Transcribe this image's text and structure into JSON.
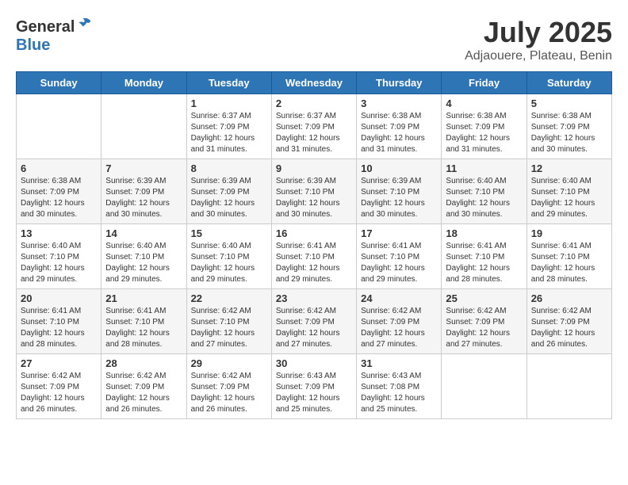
{
  "header": {
    "logo_general": "General",
    "logo_blue": "Blue",
    "month": "July 2025",
    "location": "Adjaouere, Plateau, Benin"
  },
  "weekdays": [
    "Sunday",
    "Monday",
    "Tuesday",
    "Wednesday",
    "Thursday",
    "Friday",
    "Saturday"
  ],
  "weeks": [
    [
      {
        "day": "",
        "sunrise": "",
        "sunset": "",
        "daylight": ""
      },
      {
        "day": "",
        "sunrise": "",
        "sunset": "",
        "daylight": ""
      },
      {
        "day": "1",
        "sunrise": "Sunrise: 6:37 AM",
        "sunset": "Sunset: 7:09 PM",
        "daylight": "Daylight: 12 hours and 31 minutes."
      },
      {
        "day": "2",
        "sunrise": "Sunrise: 6:37 AM",
        "sunset": "Sunset: 7:09 PM",
        "daylight": "Daylight: 12 hours and 31 minutes."
      },
      {
        "day": "3",
        "sunrise": "Sunrise: 6:38 AM",
        "sunset": "Sunset: 7:09 PM",
        "daylight": "Daylight: 12 hours and 31 minutes."
      },
      {
        "day": "4",
        "sunrise": "Sunrise: 6:38 AM",
        "sunset": "Sunset: 7:09 PM",
        "daylight": "Daylight: 12 hours and 31 minutes."
      },
      {
        "day": "5",
        "sunrise": "Sunrise: 6:38 AM",
        "sunset": "Sunset: 7:09 PM",
        "daylight": "Daylight: 12 hours and 30 minutes."
      }
    ],
    [
      {
        "day": "6",
        "sunrise": "Sunrise: 6:38 AM",
        "sunset": "Sunset: 7:09 PM",
        "daylight": "Daylight: 12 hours and 30 minutes."
      },
      {
        "day": "7",
        "sunrise": "Sunrise: 6:39 AM",
        "sunset": "Sunset: 7:09 PM",
        "daylight": "Daylight: 12 hours and 30 minutes."
      },
      {
        "day": "8",
        "sunrise": "Sunrise: 6:39 AM",
        "sunset": "Sunset: 7:09 PM",
        "daylight": "Daylight: 12 hours and 30 minutes."
      },
      {
        "day": "9",
        "sunrise": "Sunrise: 6:39 AM",
        "sunset": "Sunset: 7:10 PM",
        "daylight": "Daylight: 12 hours and 30 minutes."
      },
      {
        "day": "10",
        "sunrise": "Sunrise: 6:39 AM",
        "sunset": "Sunset: 7:10 PM",
        "daylight": "Daylight: 12 hours and 30 minutes."
      },
      {
        "day": "11",
        "sunrise": "Sunrise: 6:40 AM",
        "sunset": "Sunset: 7:10 PM",
        "daylight": "Daylight: 12 hours and 30 minutes."
      },
      {
        "day": "12",
        "sunrise": "Sunrise: 6:40 AM",
        "sunset": "Sunset: 7:10 PM",
        "daylight": "Daylight: 12 hours and 29 minutes."
      }
    ],
    [
      {
        "day": "13",
        "sunrise": "Sunrise: 6:40 AM",
        "sunset": "Sunset: 7:10 PM",
        "daylight": "Daylight: 12 hours and 29 minutes."
      },
      {
        "day": "14",
        "sunrise": "Sunrise: 6:40 AM",
        "sunset": "Sunset: 7:10 PM",
        "daylight": "Daylight: 12 hours and 29 minutes."
      },
      {
        "day": "15",
        "sunrise": "Sunrise: 6:40 AM",
        "sunset": "Sunset: 7:10 PM",
        "daylight": "Daylight: 12 hours and 29 minutes."
      },
      {
        "day": "16",
        "sunrise": "Sunrise: 6:41 AM",
        "sunset": "Sunset: 7:10 PM",
        "daylight": "Daylight: 12 hours and 29 minutes."
      },
      {
        "day": "17",
        "sunrise": "Sunrise: 6:41 AM",
        "sunset": "Sunset: 7:10 PM",
        "daylight": "Daylight: 12 hours and 29 minutes."
      },
      {
        "day": "18",
        "sunrise": "Sunrise: 6:41 AM",
        "sunset": "Sunset: 7:10 PM",
        "daylight": "Daylight: 12 hours and 28 minutes."
      },
      {
        "day": "19",
        "sunrise": "Sunrise: 6:41 AM",
        "sunset": "Sunset: 7:10 PM",
        "daylight": "Daylight: 12 hours and 28 minutes."
      }
    ],
    [
      {
        "day": "20",
        "sunrise": "Sunrise: 6:41 AM",
        "sunset": "Sunset: 7:10 PM",
        "daylight": "Daylight: 12 hours and 28 minutes."
      },
      {
        "day": "21",
        "sunrise": "Sunrise: 6:41 AM",
        "sunset": "Sunset: 7:10 PM",
        "daylight": "Daylight: 12 hours and 28 minutes."
      },
      {
        "day": "22",
        "sunrise": "Sunrise: 6:42 AM",
        "sunset": "Sunset: 7:10 PM",
        "daylight": "Daylight: 12 hours and 27 minutes."
      },
      {
        "day": "23",
        "sunrise": "Sunrise: 6:42 AM",
        "sunset": "Sunset: 7:09 PM",
        "daylight": "Daylight: 12 hours and 27 minutes."
      },
      {
        "day": "24",
        "sunrise": "Sunrise: 6:42 AM",
        "sunset": "Sunset: 7:09 PM",
        "daylight": "Daylight: 12 hours and 27 minutes."
      },
      {
        "day": "25",
        "sunrise": "Sunrise: 6:42 AM",
        "sunset": "Sunset: 7:09 PM",
        "daylight": "Daylight: 12 hours and 27 minutes."
      },
      {
        "day": "26",
        "sunrise": "Sunrise: 6:42 AM",
        "sunset": "Sunset: 7:09 PM",
        "daylight": "Daylight: 12 hours and 26 minutes."
      }
    ],
    [
      {
        "day": "27",
        "sunrise": "Sunrise: 6:42 AM",
        "sunset": "Sunset: 7:09 PM",
        "daylight": "Daylight: 12 hours and 26 minutes."
      },
      {
        "day": "28",
        "sunrise": "Sunrise: 6:42 AM",
        "sunset": "Sunset: 7:09 PM",
        "daylight": "Daylight: 12 hours and 26 minutes."
      },
      {
        "day": "29",
        "sunrise": "Sunrise: 6:42 AM",
        "sunset": "Sunset: 7:09 PM",
        "daylight": "Daylight: 12 hours and 26 minutes."
      },
      {
        "day": "30",
        "sunrise": "Sunrise: 6:43 AM",
        "sunset": "Sunset: 7:09 PM",
        "daylight": "Daylight: 12 hours and 25 minutes."
      },
      {
        "day": "31",
        "sunrise": "Sunrise: 6:43 AM",
        "sunset": "Sunset: 7:08 PM",
        "daylight": "Daylight: 12 hours and 25 minutes."
      },
      {
        "day": "",
        "sunrise": "",
        "sunset": "",
        "daylight": ""
      },
      {
        "day": "",
        "sunrise": "",
        "sunset": "",
        "daylight": ""
      }
    ]
  ]
}
